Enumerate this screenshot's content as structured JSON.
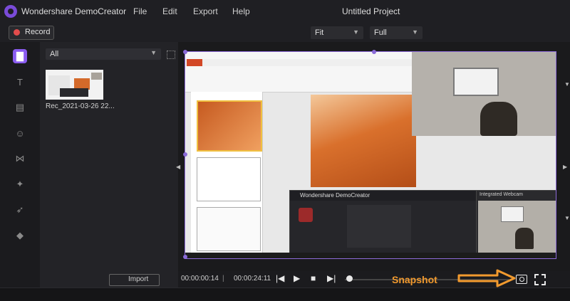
{
  "app": {
    "name": "Wondershare DemoCreator",
    "project_title": "Untitled Project"
  },
  "menu": [
    "File",
    "Edit",
    "Export",
    "Help"
  ],
  "toolbar": {
    "record_label": "Record",
    "fit_label": "Fit",
    "quality_label": "Full"
  },
  "sidebar": {
    "items": [
      {
        "icon": "folder-icon",
        "active": true
      },
      {
        "icon": "text-icon"
      },
      {
        "icon": "annotation-icon"
      },
      {
        "icon": "sticker-icon"
      },
      {
        "icon": "transition-icon"
      },
      {
        "icon": "effects-icon"
      },
      {
        "icon": "cursor-icon"
      },
      {
        "icon": "eraser-icon"
      }
    ]
  },
  "library": {
    "filter": "All",
    "items": [
      {
        "label": "Rec_2021-03-26 22..."
      }
    ],
    "import_label": "Import"
  },
  "preview": {
    "dc_window_title": "Wondershare DemoCreator",
    "webcam_window_title": "Integrated Webcam"
  },
  "playback": {
    "current_time": "00:00:00:14",
    "separator": "|",
    "total_time": "00:00:24:11",
    "progress": 0.0
  },
  "annotation": {
    "snapshot_label": "Snapshot",
    "accent": "#f29a2e"
  }
}
